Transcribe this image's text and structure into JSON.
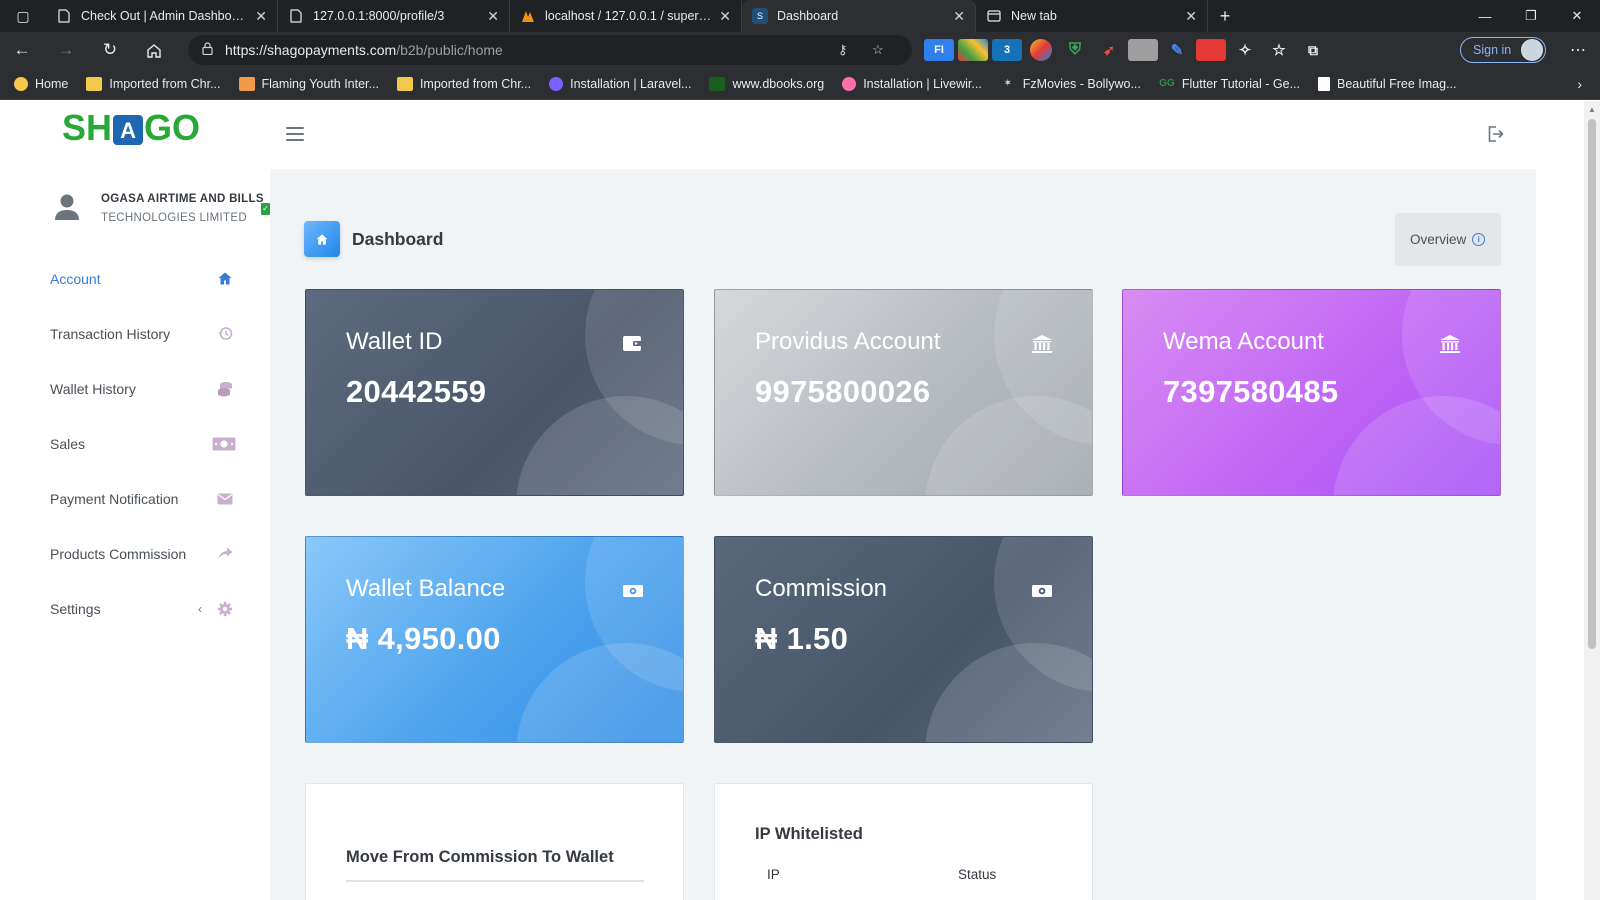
{
  "browser": {
    "tabs": [
      {
        "title": "Check Out | Admin Dashboard",
        "icon": "page-icon",
        "active": false
      },
      {
        "title": "127.0.0.1:8000/profile/3",
        "icon": "page-icon",
        "active": false
      },
      {
        "title": "localhost / 127.0.0.1 / supervms",
        "icon": "phpmyadmin-icon",
        "active": false
      },
      {
        "title": "Dashboard",
        "icon": "shago-favicon",
        "active": true
      },
      {
        "title": "New tab",
        "icon": "newtab-icon",
        "active": false
      }
    ],
    "url_host": "https://shagopayments.com",
    "url_path": "/b2b/public/home",
    "signin_label": "Sign in",
    "bookmarks": [
      {
        "label": "Home",
        "icon": "home-icon"
      },
      {
        "label": "Imported from Chr...",
        "icon": "folder-icon"
      },
      {
        "label": "Flaming Youth Inter...",
        "icon": "bookmark-icon"
      },
      {
        "label": "Imported from Chr...",
        "icon": "folder-icon"
      },
      {
        "label": "Installation | Laravel...",
        "icon": "laravel-icon"
      },
      {
        "label": "www.dbooks.org",
        "icon": "book-icon"
      },
      {
        "label": "Installation | Livewir...",
        "icon": "livewire-icon"
      },
      {
        "label": "FzMovies - Bollywo...",
        "icon": "movie-icon"
      },
      {
        "label": "Flutter Tutorial - Ge...",
        "icon": "gfg-icon"
      },
      {
        "label": "Beautiful Free Imag...",
        "icon": "unsplash-icon"
      }
    ]
  },
  "app": {
    "logo_left": "SH",
    "logo_mid": "A",
    "logo_right": "GO",
    "user_name": "OGASA AIRTIME AND BILLS",
    "user_sub": "TECHNOLOGIES LIMITED"
  },
  "sidebar": {
    "items": [
      {
        "label": "Account",
        "icon": "home-icon",
        "active": true
      },
      {
        "label": "Transaction History",
        "icon": "history-icon"
      },
      {
        "label": "Wallet History",
        "icon": "coins-icon"
      },
      {
        "label": "Sales",
        "icon": "money-icon"
      },
      {
        "label": "Payment Notification",
        "icon": "envelope-icon"
      },
      {
        "label": "Products Commission",
        "icon": "share-icon"
      },
      {
        "label": "Settings",
        "icon": "gear-icon"
      }
    ]
  },
  "main": {
    "page_title": "Dashboard",
    "overview_label": "Overview",
    "cards": [
      {
        "label": "Wallet ID",
        "value": "20442559",
        "icon": "wallet-icon"
      },
      {
        "label": "Providus Account",
        "value": "9975800026",
        "icon": "bank-icon"
      },
      {
        "label": "Wema Account",
        "value": "7397580485",
        "icon": "bank-icon"
      },
      {
        "label": "Wallet Balance",
        "value": "₦ 4,950.00",
        "icon": "money-icon"
      },
      {
        "label": "Commission",
        "value": "₦ 1.50",
        "icon": "money-icon"
      }
    ],
    "panels": {
      "move_title": "Move From Commission To Wallet",
      "ip_title": "IP Whitelisted",
      "ip_col1": "IP",
      "ip_col2": "Status"
    }
  },
  "colors": {
    "brand_green": "#29a837",
    "brand_blue": "#1f66b3",
    "accent": "#3a7bd5"
  }
}
